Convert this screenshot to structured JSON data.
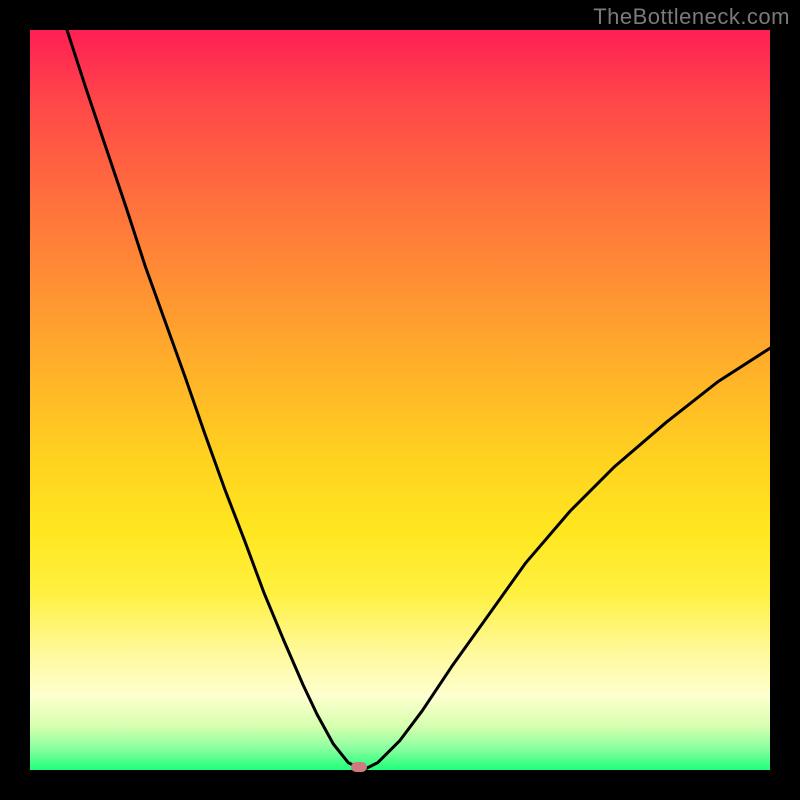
{
  "watermark": "TheBottleneck.com",
  "chart_data": {
    "type": "line",
    "title": "",
    "xlabel": "",
    "ylabel": "",
    "xlim": [
      0,
      100
    ],
    "ylim": [
      0,
      100
    ],
    "series": [
      {
        "name": "bottleneck-curve",
        "x": [
          5.0,
          7.6,
          10.3,
          13.0,
          15.6,
          18.3,
          21.0,
          23.6,
          26.3,
          29.0,
          31.6,
          34.3,
          36.9,
          38.8,
          41.0,
          43.0,
          45.0,
          47.0,
          50.0,
          53.0,
          57.0,
          62.0,
          67.0,
          73.0,
          79.0,
          86.0,
          93.0,
          100.0
        ],
        "values": [
          100.0,
          92.0,
          84.0,
          76.0,
          68.0,
          60.5,
          53.0,
          45.5,
          38.0,
          31.0,
          24.0,
          17.5,
          11.5,
          7.5,
          3.5,
          1.0,
          0.0,
          1.0,
          4.0,
          8.0,
          14.0,
          21.0,
          28.0,
          35.0,
          41.0,
          47.0,
          52.5,
          57.0
        ]
      }
    ],
    "marker": {
      "x": 44.5,
      "y": 0.4
    },
    "gradient_stops": [
      {
        "pos": 0,
        "color": "#ff1f55"
      },
      {
        "pos": 10,
        "color": "#ff4848"
      },
      {
        "pos": 22,
        "color": "#ff6d3e"
      },
      {
        "pos": 34,
        "color": "#ff8f34"
      },
      {
        "pos": 46,
        "color": "#ffb129"
      },
      {
        "pos": 58,
        "color": "#ffd21f"
      },
      {
        "pos": 68,
        "color": "#ffe720"
      },
      {
        "pos": 76,
        "color": "#fff040"
      },
      {
        "pos": 84,
        "color": "#fff99a"
      },
      {
        "pos": 90,
        "color": "#fdffcf"
      },
      {
        "pos": 94,
        "color": "#d8ffb0"
      },
      {
        "pos": 97,
        "color": "#8dffa0"
      },
      {
        "pos": 100,
        "color": "#1fff7a"
      }
    ]
  }
}
